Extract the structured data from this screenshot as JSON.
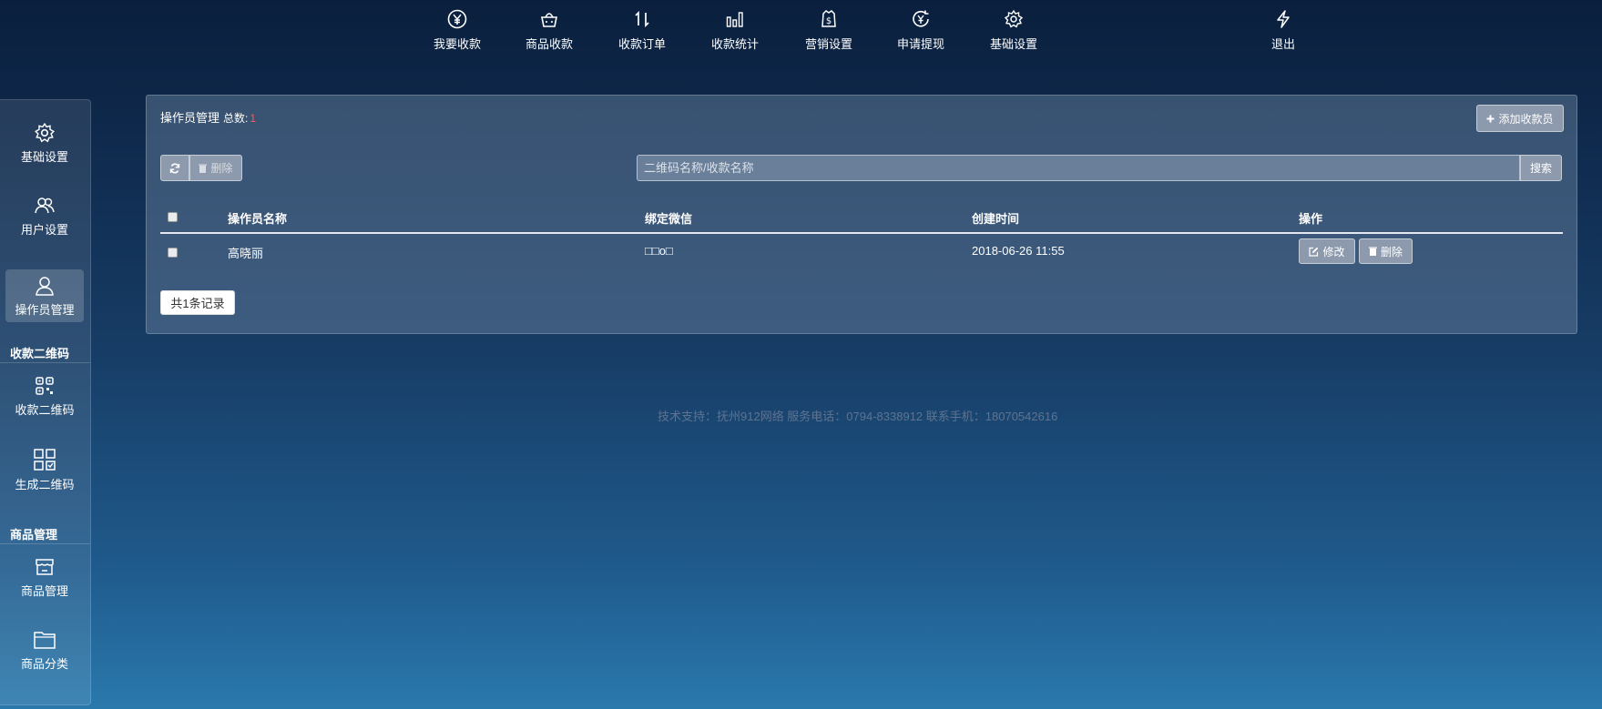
{
  "topnav": {
    "items": [
      {
        "label": "我要收款",
        "icon": "yen-circle-icon"
      },
      {
        "label": "商品收款",
        "icon": "basket-icon"
      },
      {
        "label": "收款订单",
        "icon": "sort-arrows-icon"
      },
      {
        "label": "收款统计",
        "icon": "bar-chart-icon"
      },
      {
        "label": "营销设置",
        "icon": "dollar-bag-icon"
      },
      {
        "label": "申请提现",
        "icon": "yen-refresh-icon"
      },
      {
        "label": "基础设置",
        "icon": "gear-icon"
      }
    ],
    "logout": {
      "label": "退出",
      "icon": "bolt-icon"
    }
  },
  "sidebar": {
    "items": [
      {
        "label": "基础设置",
        "icon": "gear-icon"
      },
      {
        "label": "用户设置",
        "icon": "users-icon"
      },
      {
        "label": "操作员管理",
        "icon": "user-icon",
        "active": true
      }
    ],
    "groups": [
      {
        "title": "收款二维码",
        "items": [
          {
            "label": "收款二维码",
            "icon": "qrcode-icon"
          },
          {
            "label": "生成二维码",
            "icon": "qrcode-generate-icon"
          }
        ]
      },
      {
        "title": "商品管理",
        "items": [
          {
            "label": "商品管理",
            "icon": "store-icon"
          },
          {
            "label": "商品分类",
            "icon": "folder-icon"
          }
        ]
      }
    ]
  },
  "panel": {
    "title": "操作员管理",
    "total_label": "总数:",
    "total_count": "1",
    "add_button": "添加收款员",
    "toolbar": {
      "delete_label": "删除",
      "search_placeholder": "二维码名称/收款名称",
      "search_button": "搜索"
    },
    "table": {
      "columns": [
        "操作员名称",
        "绑定微信",
        "创建时间",
        "操作"
      ],
      "rows": [
        {
          "name": "高晓丽",
          "wechat": "□□o□",
          "created": "2018-06-26 11:55",
          "edit": "修改",
          "delete": "删除"
        }
      ]
    },
    "record_total": "共1条记录"
  },
  "footer": {
    "text": "技术支持：抚州912网络 服务电话：0794-8338912  联系手机：18070542616"
  },
  "colors": {
    "accent_red": "#ff5a5a",
    "button_gray": "#8d9aad"
  }
}
